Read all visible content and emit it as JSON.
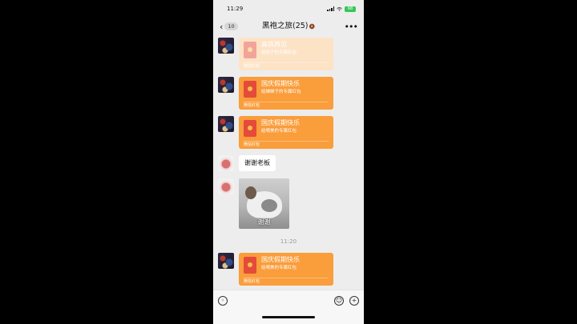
{
  "status_bar": {
    "time": "11:29",
    "battery": "68"
  },
  "nav": {
    "back_count": "10",
    "title": "黑袍之旅(25)",
    "mute_icon": "bell-slash-icon",
    "more_icon": "more-icon"
  },
  "messages": [
    {
      "type": "red_packet",
      "state": "opened",
      "title": "高铁再见",
      "desc": "给侠子的专属红包",
      "footer": "微信红包"
    },
    {
      "type": "red_packet",
      "state": "unopened",
      "title": "国庆假期快乐",
      "desc": "给婵婵子的专属红包",
      "footer": "微信红包"
    },
    {
      "type": "red_packet",
      "state": "unopened",
      "title": "国庆假期快乐",
      "desc": "给嘀美的专属红包",
      "footer": "微信红包"
    },
    {
      "type": "text",
      "text": "谢谢老板"
    },
    {
      "type": "sticker",
      "caption": "谢谢"
    },
    {
      "type": "time",
      "text": "11:20"
    },
    {
      "type": "red_packet",
      "state": "unopened",
      "title": "国庆假期快乐",
      "desc": "给嘀美的专属红包",
      "footer": "微信红包"
    }
  ],
  "input_bar": {
    "voice_icon": "voice-icon",
    "emoji_icon": "emoji-icon",
    "plus_icon": "plus-icon",
    "placeholder": ""
  },
  "colors": {
    "red_packet": "#fa9d3b",
    "red_packet_opened": "#fde3c6",
    "background": "#ededed"
  }
}
